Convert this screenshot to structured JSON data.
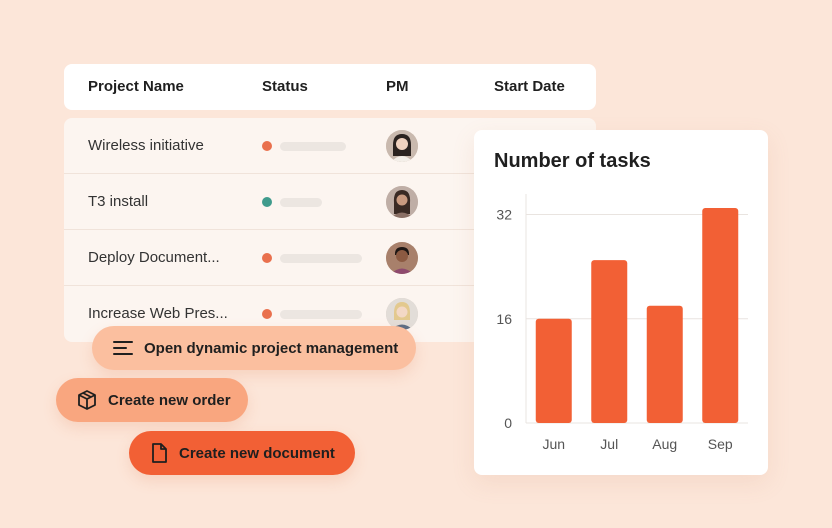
{
  "table": {
    "headers": [
      "Project Name",
      "Status",
      "PM",
      "Start Date"
    ],
    "rows": [
      {
        "name": "Wireless initiative",
        "status_color": "#e9704d",
        "status_level": 0.55
      },
      {
        "name": "T3 install",
        "status_color": "#3f9b8c",
        "status_level": 0.35
      },
      {
        "name": "Deploy Document...",
        "status_color": "#e9704d",
        "status_level": 0.68
      },
      {
        "name": "Increase Web Pres...",
        "status_color": "#e9704d",
        "status_level": 0.68
      }
    ]
  },
  "actions": {
    "open_pm": "Open dynamic project management",
    "new_order": "Create new order",
    "new_doc": "Create new document"
  },
  "colors": {
    "background": "#fce6d9",
    "accent": "#f26035",
    "pill_light": "#fbbf9f",
    "pill_mid": "#f9a67f"
  },
  "chart_data": {
    "type": "bar",
    "title": "Number of tasks",
    "categories": [
      "Jun",
      "Jul",
      "Aug",
      "Sep"
    ],
    "values": [
      16,
      25,
      18,
      33
    ],
    "yticks": [
      0,
      16,
      32
    ],
    "ylim": [
      0,
      33
    ],
    "grid": true,
    "bar_color": "#f26035"
  }
}
